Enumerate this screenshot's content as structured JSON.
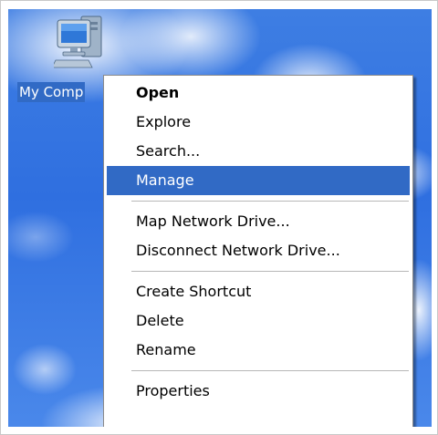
{
  "desktop": {
    "icon": {
      "name": "my-computer-icon",
      "label": "My Comp"
    }
  },
  "context_menu": {
    "highlighted_item": "Manage",
    "highlight_color": "#316ac5",
    "groups": [
      {
        "items": [
          "Open",
          "Explore",
          "Search...",
          "Manage"
        ]
      },
      {
        "items": [
          "Map Network Drive...",
          "Disconnect Network Drive..."
        ]
      },
      {
        "items": [
          "Create Shortcut",
          "Delete",
          "Rename"
        ]
      },
      {
        "items": [
          "Properties"
        ]
      }
    ],
    "open_label": "Open",
    "explore_label": "Explore",
    "search_label": "Search...",
    "manage_label": "Manage",
    "map_drive_label": "Map Network Drive...",
    "disconnect_drive_label": "Disconnect Network Drive...",
    "create_shortcut_label": "Create Shortcut",
    "delete_label": "Delete",
    "rename_label": "Rename",
    "properties_label": "Properties"
  }
}
